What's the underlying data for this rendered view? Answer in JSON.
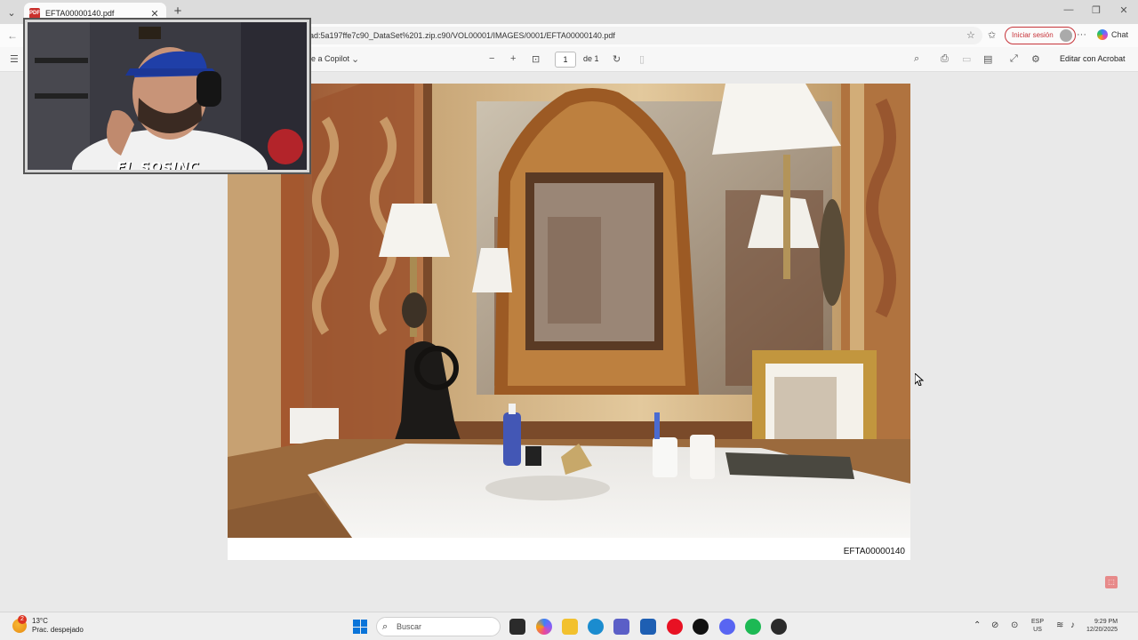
{
  "browser": {
    "tab_title": "EFTA00000140.pdf",
    "tab_close": "✕",
    "new_tab": "+",
    "url": "ad:5a197ffe7c90_DataSet%201.zip.c90/VOL00001/IMAGES/0001/EFTA00000140.pdf",
    "signin_label": "Iniciar sesión",
    "chat_label": "Chat",
    "more_label": "···"
  },
  "pdf_toolbar": {
    "copilot_label": "e a Copilot",
    "page_current": "1",
    "page_of": "de 1",
    "zoom_out": "−",
    "zoom_in": "+",
    "edit_acrobat": "Editar con Acrobat"
  },
  "document": {
    "doc_id": "EFTA00000140"
  },
  "webcam": {
    "label": "EL SOSINC"
  },
  "taskbar": {
    "weather_temp": "13°C",
    "weather_desc": "Prac. despejado",
    "weather_badge": "2",
    "search_placeholder": "Buscar",
    "lang_top": "ESP",
    "lang_bottom": "US",
    "time": "9:29 PM",
    "date": "12/20/2025"
  }
}
